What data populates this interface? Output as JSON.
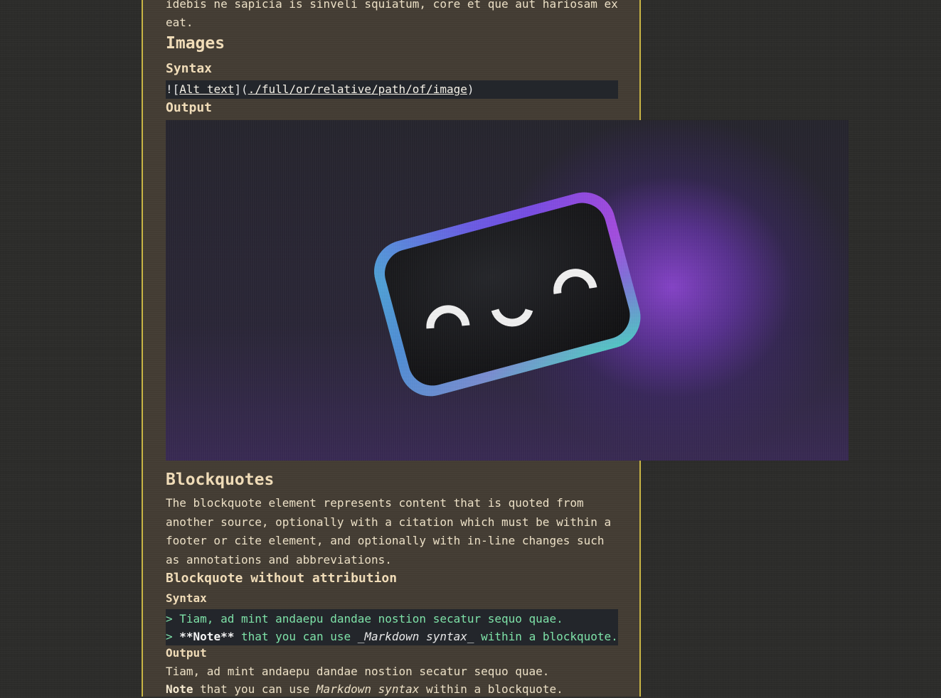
{
  "colors": {
    "page_background": "#2c2c2a",
    "column_background": "#433c33",
    "column_border": "#c9b545",
    "heading": "#f0dcb8",
    "text": "#ece0c6",
    "code_background": "#23262b",
    "blockquote_code_text": "#7ee2a8"
  },
  "previous_paragraph": {
    "line1": "idebis ne sapicia is sinveli squiatum, core et que aut hariosam ex",
    "line2": "eat."
  },
  "images_section": {
    "heading": "Images",
    "syntax_label": "Syntax",
    "code": {
      "bang": "!",
      "open_bracket": "[",
      "alt_text": "Alt text",
      "close_bracket_paren": "](",
      "path": "./full/or/relative/path/of/image",
      "close_paren": ")"
    },
    "output_label": "Output",
    "image": {
      "description_icon": "smiling-rounded-rectangle-logo-icon"
    }
  },
  "blockquotes_section": {
    "heading": "Blockquotes",
    "description": "The blockquote element represents content that is quoted from another source, optionally with a citation which must be within a footer or cite element, and optionally with in-line changes such as annotations and abbreviations.",
    "subheading": "Blockquote without attribution",
    "syntax_label": "Syntax",
    "code_line1": {
      "marker": ">",
      "text": " Tiam, ad mint andaepu dandae nostion secatur sequo quae."
    },
    "code_line2": {
      "marker": ">",
      "strong": " **Note**",
      "mid": " that you can use ",
      "em": "_Markdown syntax_",
      "end": " within a blockquote."
    },
    "output_label": "Output",
    "output_line1": "Tiam, ad mint andaepu dandae nostion secatur sequo quae.",
    "output_line2": {
      "bold": "Note",
      "mid": " that you can use ",
      "italic": "Markdown syntax",
      "end": " within a blockquote."
    }
  }
}
